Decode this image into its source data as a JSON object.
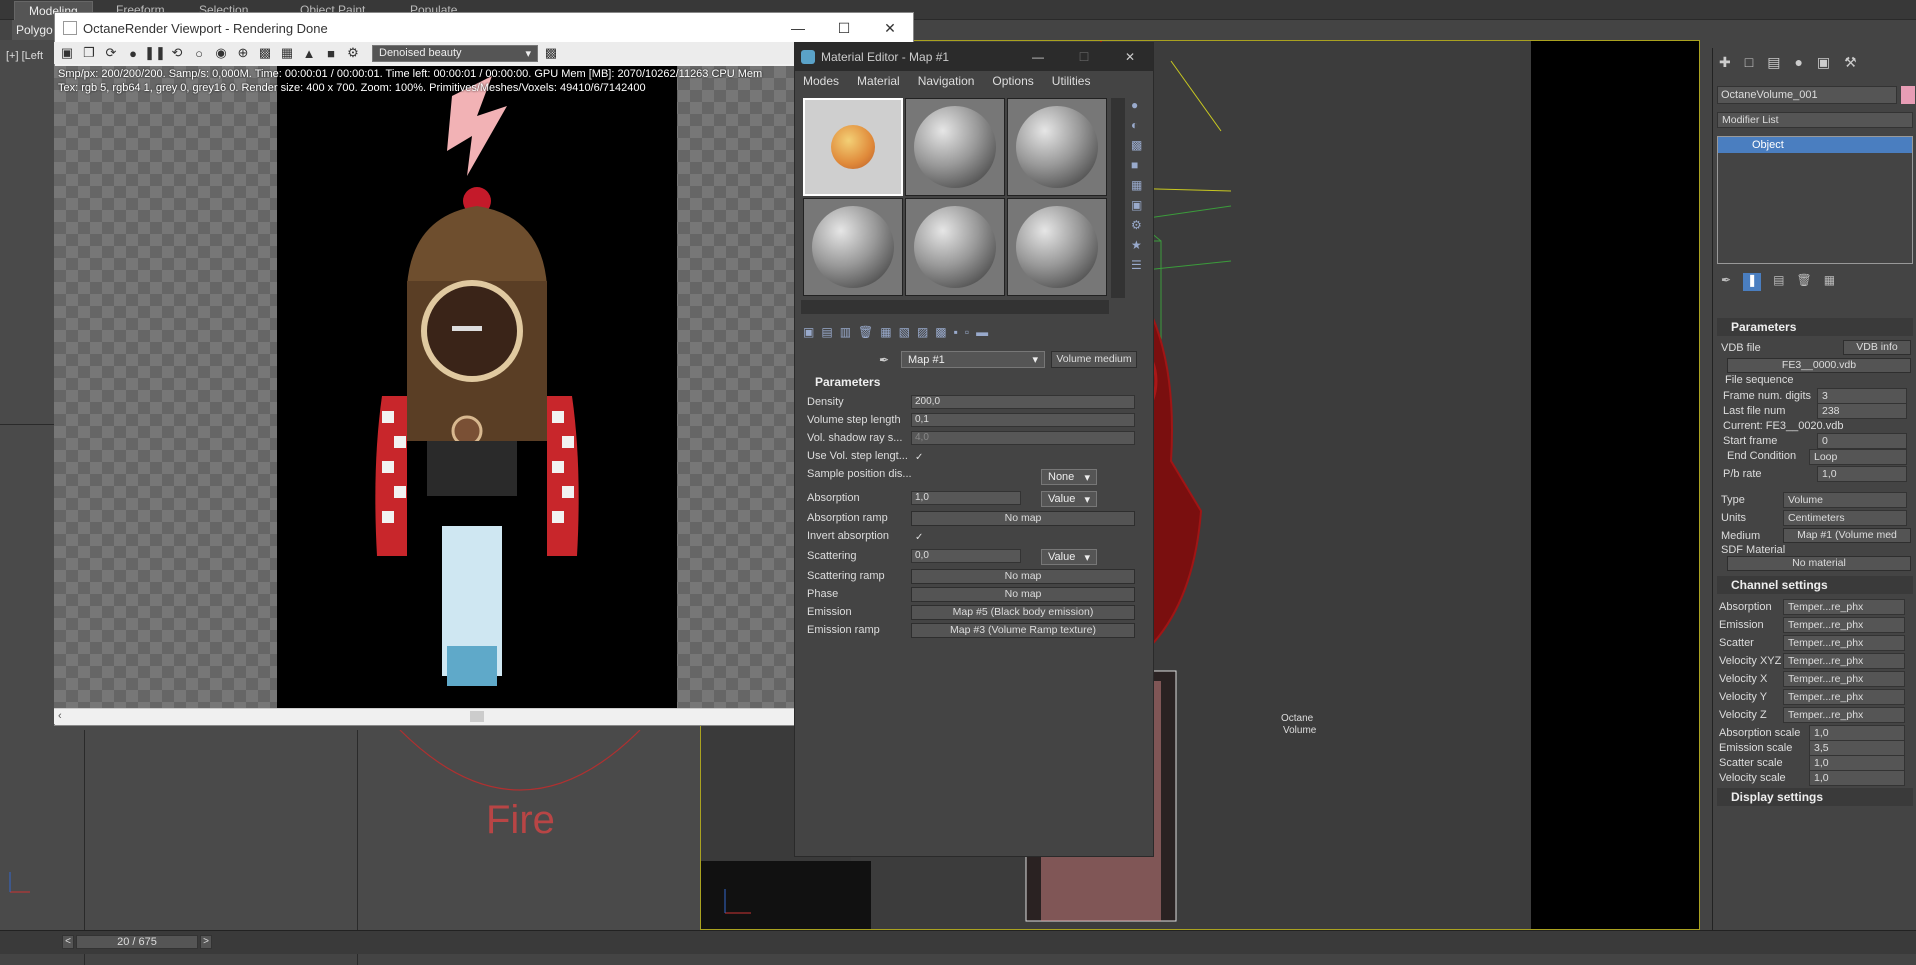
{
  "top_tabs": [
    "Modeling",
    "Freeform",
    "Selection",
    "Object Paint",
    "Populate"
  ],
  "ribbon_label": "Polygo",
  "left_viewport": {
    "label": "[+] [Left",
    "fire_text": "Fire"
  },
  "octane_window": {
    "title": "OctaneRender Viewport - Rendering Done",
    "display_mode": "Denoised beauty",
    "hud_line1": "Smp/px: 200/200/200.   Samp/s: 0,000M.   Time: 00:00:01 / 00:00:01.   Time left: 00:00:01 / 00:00:00.   GPU Mem [MB]: 2070/10262/11263   CPU Mem",
    "hud_line2": "Tex: rgb 5, rgb64 1, grey 0, grey16 0.   Render size: 400 x 700.   Zoom: 100%.   Primitives/Meshes/Voxels: 49410/6/7142400"
  },
  "material_editor": {
    "title": "Material Editor - Map #1",
    "menu": [
      "Modes",
      "Material",
      "Navigation",
      "Options",
      "Utilities"
    ],
    "map_name": "Map #1",
    "map_type": "Volume medium",
    "section": "Parameters",
    "params": {
      "density_label": "Density",
      "density": "200,0",
      "step_label": "Volume step length",
      "step": "0,1",
      "shadow_label": "Vol. shadow ray s...",
      "shadow": "4,0",
      "use_step_label": "Use Vol. step lengt...",
      "sample_label": "Sample position dis...",
      "sample": "None",
      "absorption_label": "Absorption",
      "absorption": "1,0",
      "absorption_mode": "Value",
      "abs_ramp_label": "Absorption ramp",
      "abs_ramp": "No map",
      "invert_label": "Invert absorption",
      "scattering_label": "Scattering",
      "scattering": "0,0",
      "scattering_mode": "Value",
      "scat_ramp_label": "Scattering ramp",
      "scat_ramp": "No map",
      "phase_label": "Phase",
      "phase": "No map",
      "emission_label": "Emission",
      "emission": "Map #5 (Black body emission)",
      "em_ramp_label": "Emission ramp",
      "em_ramp": "Map #3 (Volume Ramp texture)"
    }
  },
  "viewport_right": {
    "object_label_1": "Octane",
    "object_label_2": "Volume"
  },
  "command_panel": {
    "object_name": "OctaneVolume_001",
    "modifier_list": "Modifier List",
    "stack_item": "Object",
    "parameters": "Parameters",
    "vdb_file_label": "VDB file",
    "vdb_info": "VDB info",
    "vdb_file": "FE3__0000.vdb",
    "file_sequence": "File sequence",
    "frame_digits_label": "Frame num. digits",
    "frame_digits": "3",
    "last_file_label": "Last file num",
    "last_file": "238",
    "current": "Current: FE3__0020.vdb",
    "start_frame_label": "Start frame",
    "start_frame": "0",
    "end_condition_label": "End Condition",
    "end_condition": "Loop",
    "pb_rate_label": "P/b rate",
    "pb_rate": "1,0",
    "type_label": "Type",
    "type": "Volume",
    "units_label": "Units",
    "units": "Centimeters",
    "medium_label": "Medium",
    "medium": "Map #1 (Volume med",
    "sdf_label": "SDF Material",
    "sdf": "No material",
    "channel_settings": "Channel settings",
    "channels": [
      {
        "label": "Absorption",
        "value": "Temper...re_phx"
      },
      {
        "label": "Emission",
        "value": "Temper...re_phx"
      },
      {
        "label": "Scatter",
        "value": "Temper...re_phx"
      },
      {
        "label": "Velocity XYZ",
        "value": "Temper...re_phx"
      },
      {
        "label": "Velocity X",
        "value": "Temper...re_phx"
      },
      {
        "label": "Velocity Y",
        "value": "Temper...re_phx"
      },
      {
        "label": "Velocity Z",
        "value": "Temper...re_phx"
      }
    ],
    "scales": [
      {
        "label": "Absorption scale",
        "value": "1,0"
      },
      {
        "label": "Emission scale",
        "value": "3,5"
      },
      {
        "label": "Scatter scale",
        "value": "1,0"
      },
      {
        "label": "Velocity scale",
        "value": "1,0"
      }
    ],
    "display_settings": "Display settings"
  },
  "timeline": {
    "frame": "20 / 675"
  }
}
